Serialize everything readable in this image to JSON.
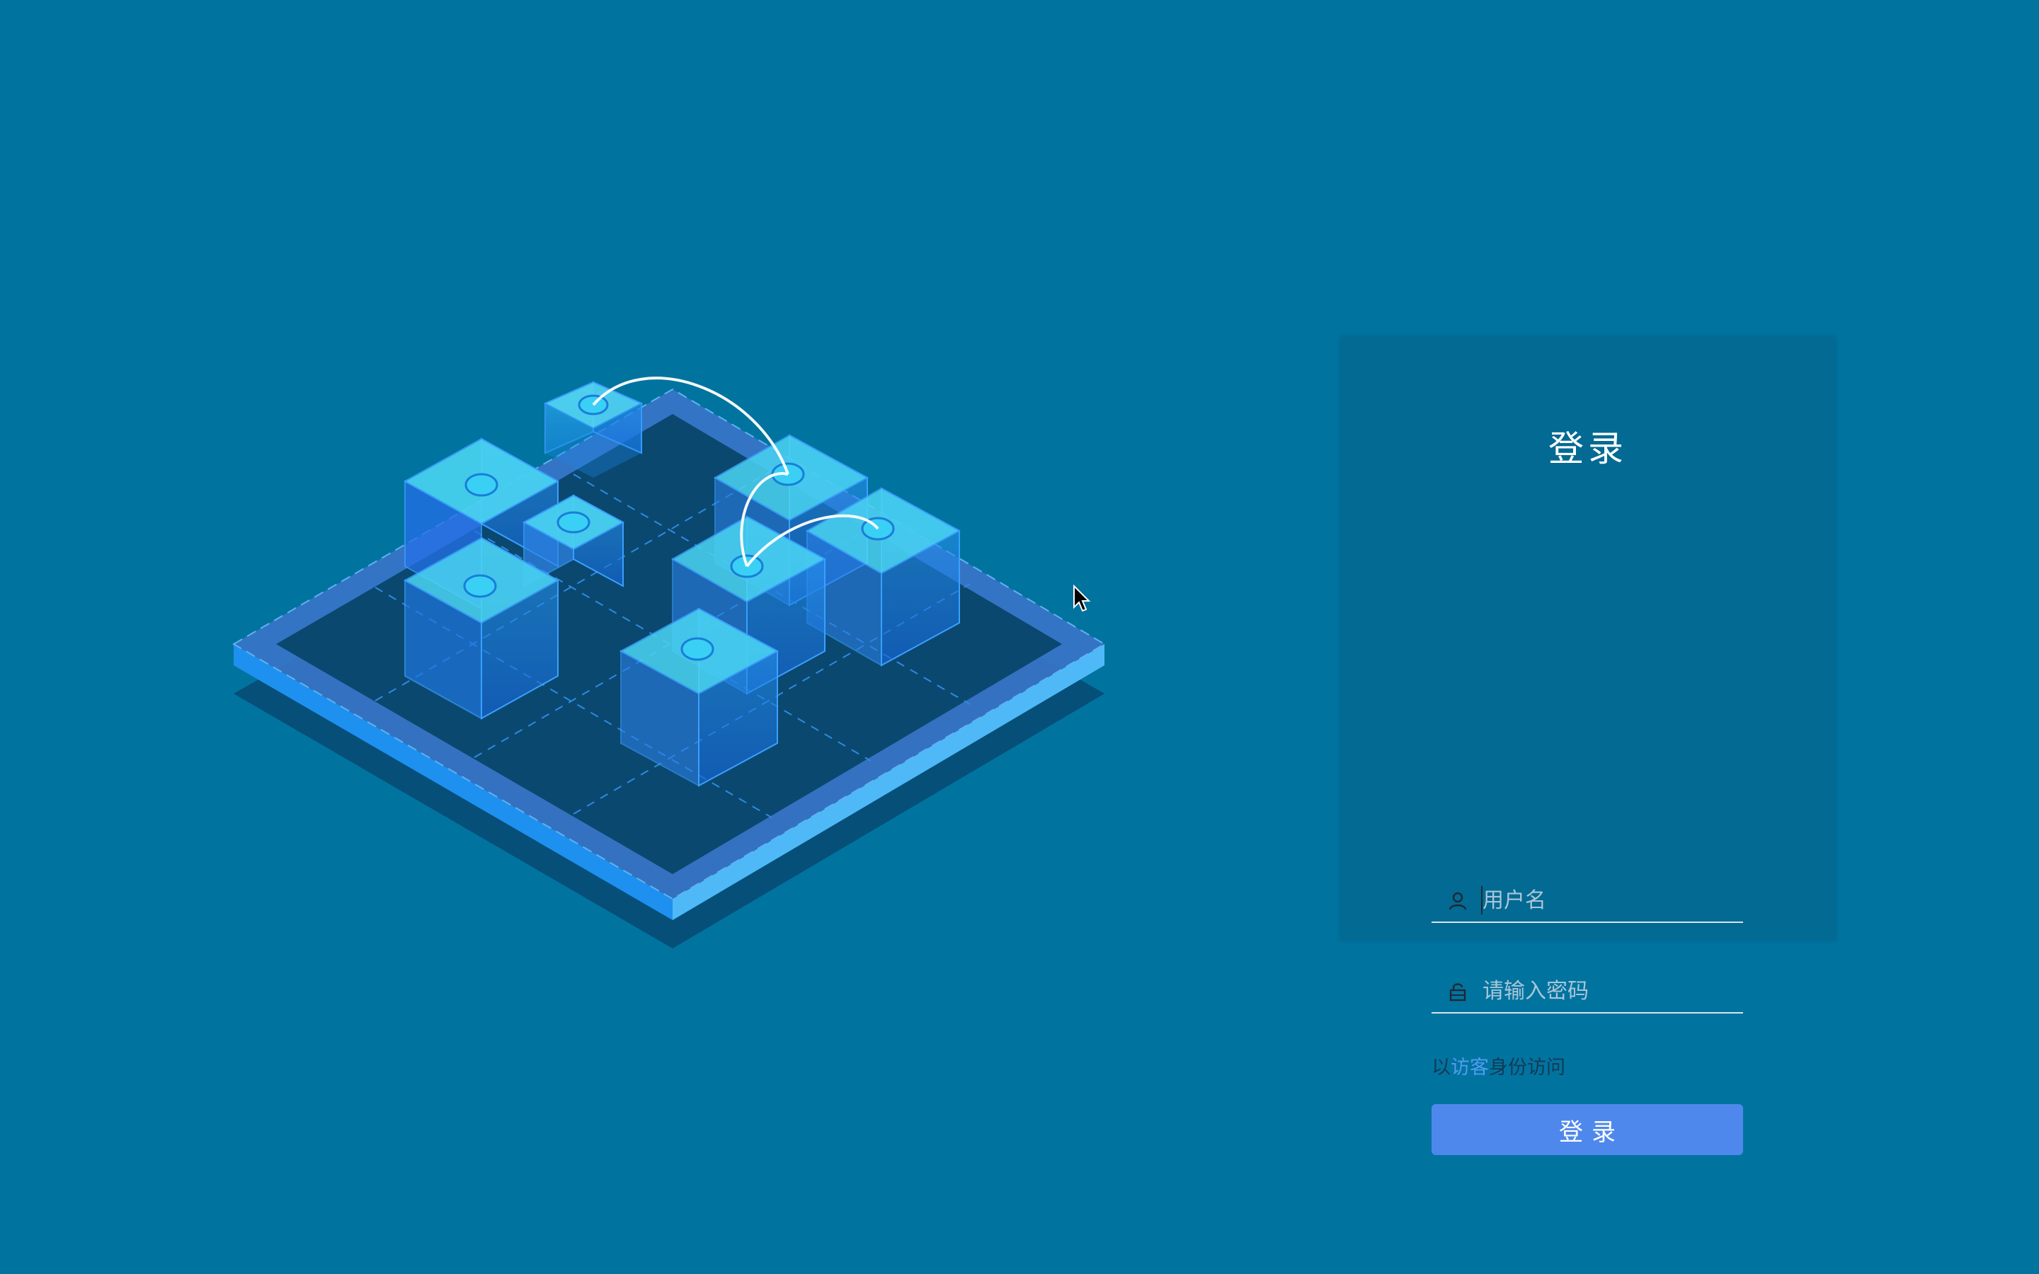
{
  "login": {
    "title": "登录",
    "username": {
      "placeholder": "用户名",
      "value": "",
      "icon": "user-icon"
    },
    "password": {
      "placeholder": "请输入密码",
      "value": "",
      "icon": "lock-icon"
    },
    "guest": {
      "prefix": "以",
      "link": "访客",
      "suffix": "身份访问"
    },
    "button_label": "登录"
  },
  "colors": {
    "background": "#01739f",
    "card": "#026a93",
    "button": "#4f88ec",
    "link": "#4f9cf0"
  }
}
